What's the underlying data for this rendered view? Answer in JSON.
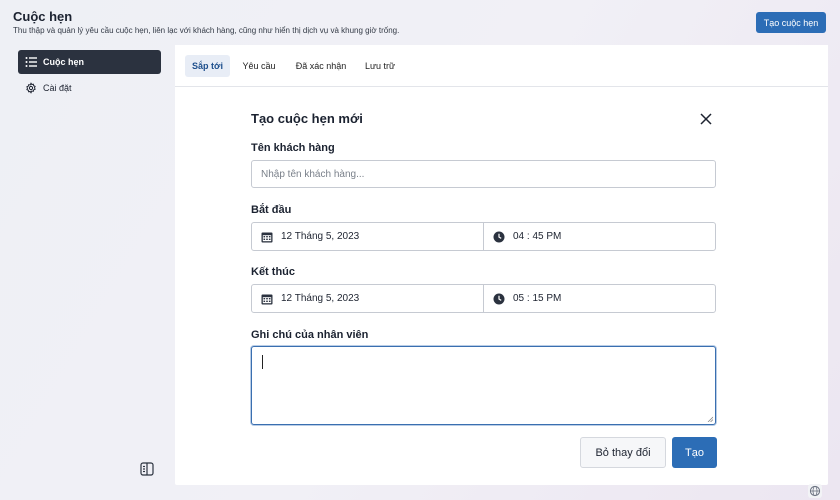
{
  "header": {
    "title": "Cuộc hẹn",
    "subtitle": "Thu thập và quản lý yêu cầu cuộc hẹn, liên lạc với khách hàng, cũng như hiển thị dịch vụ và khung giờ trống.",
    "create_button": "Tạo cuộc hẹn"
  },
  "sidebar": {
    "items": [
      {
        "label": "Cuộc hẹn",
        "icon": "list-icon",
        "active": true
      },
      {
        "label": "Cài đặt",
        "icon": "gear-icon",
        "active": false
      }
    ]
  },
  "tabs": [
    {
      "label": "Sắp tới",
      "active": true
    },
    {
      "label": "Yêu cầu",
      "active": false
    },
    {
      "label": "Đã xác nhận",
      "active": false
    },
    {
      "label": "Lưu trữ",
      "active": false
    }
  ],
  "form": {
    "title": "Tạo cuộc hẹn mới",
    "customer_label": "Tên khách hàng",
    "customer_placeholder": "Nhập tên khách hàng...",
    "start_label": "Bắt đầu",
    "start_date": "12 Tháng 5, 2023",
    "start_time": "04 : 45 PM",
    "end_label": "Kết thúc",
    "end_date": "12 Tháng 5, 2023",
    "end_time": "05 : 15 PM",
    "note_label": "Ghi chú của nhân viên",
    "note_value": "",
    "discard_button": "Bỏ thay đổi",
    "submit_button": "Tạo"
  },
  "colors": {
    "accent": "#2c6db6",
    "sidebar_active_bg": "#2b323f",
    "tab_active_bg": "#e8edf6"
  }
}
